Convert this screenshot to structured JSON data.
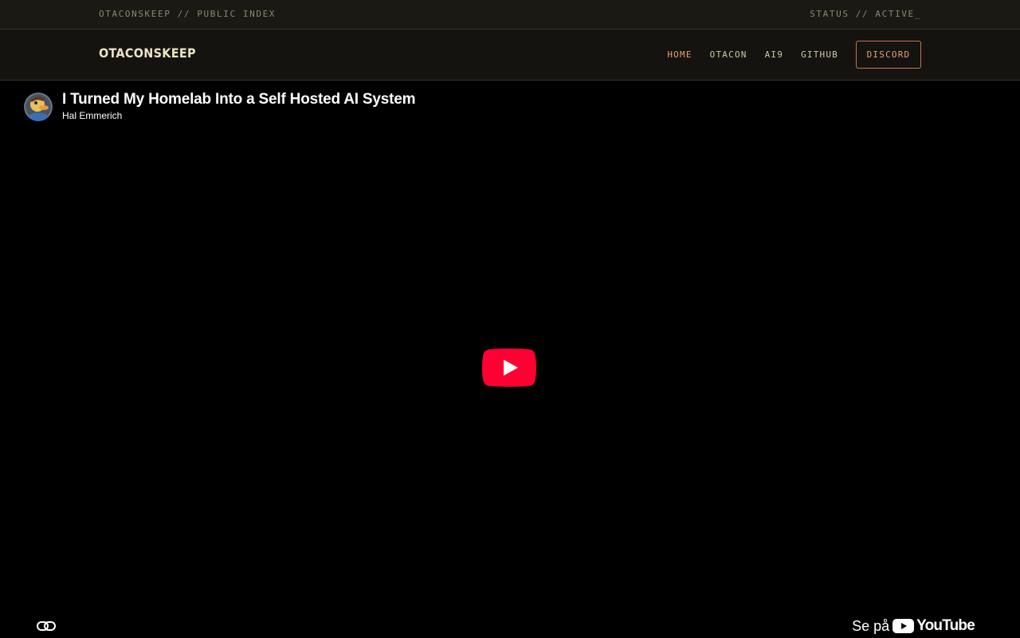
{
  "topbar": {
    "left_text": "OTACONSKEEP // PUBLIC INDEX",
    "right_text": "STATUS // ACTIVE_"
  },
  "navbar": {
    "logo": "OTACONSKEEP",
    "items": [
      {
        "label": "HOME",
        "active": true
      },
      {
        "label": "OTACON"
      },
      {
        "label": "AI9"
      },
      {
        "label": "GITHUB"
      }
    ],
    "discord_label": "DISCORD",
    "colors": {
      "accent": "#e8a070",
      "text": "#cfc6a9",
      "bar": "#14130f"
    }
  },
  "video": {
    "title": "I Turned My Homelab Into a Self Hosted AI System",
    "channel": "Hal Emmerich",
    "watch_on_label": "Se på",
    "youtube_wordmark": "YouTube",
    "icons": [
      "avatar",
      "play-icon",
      "link-icon",
      "youtube-logo-icon"
    ],
    "play_color": "#ff0033"
  }
}
